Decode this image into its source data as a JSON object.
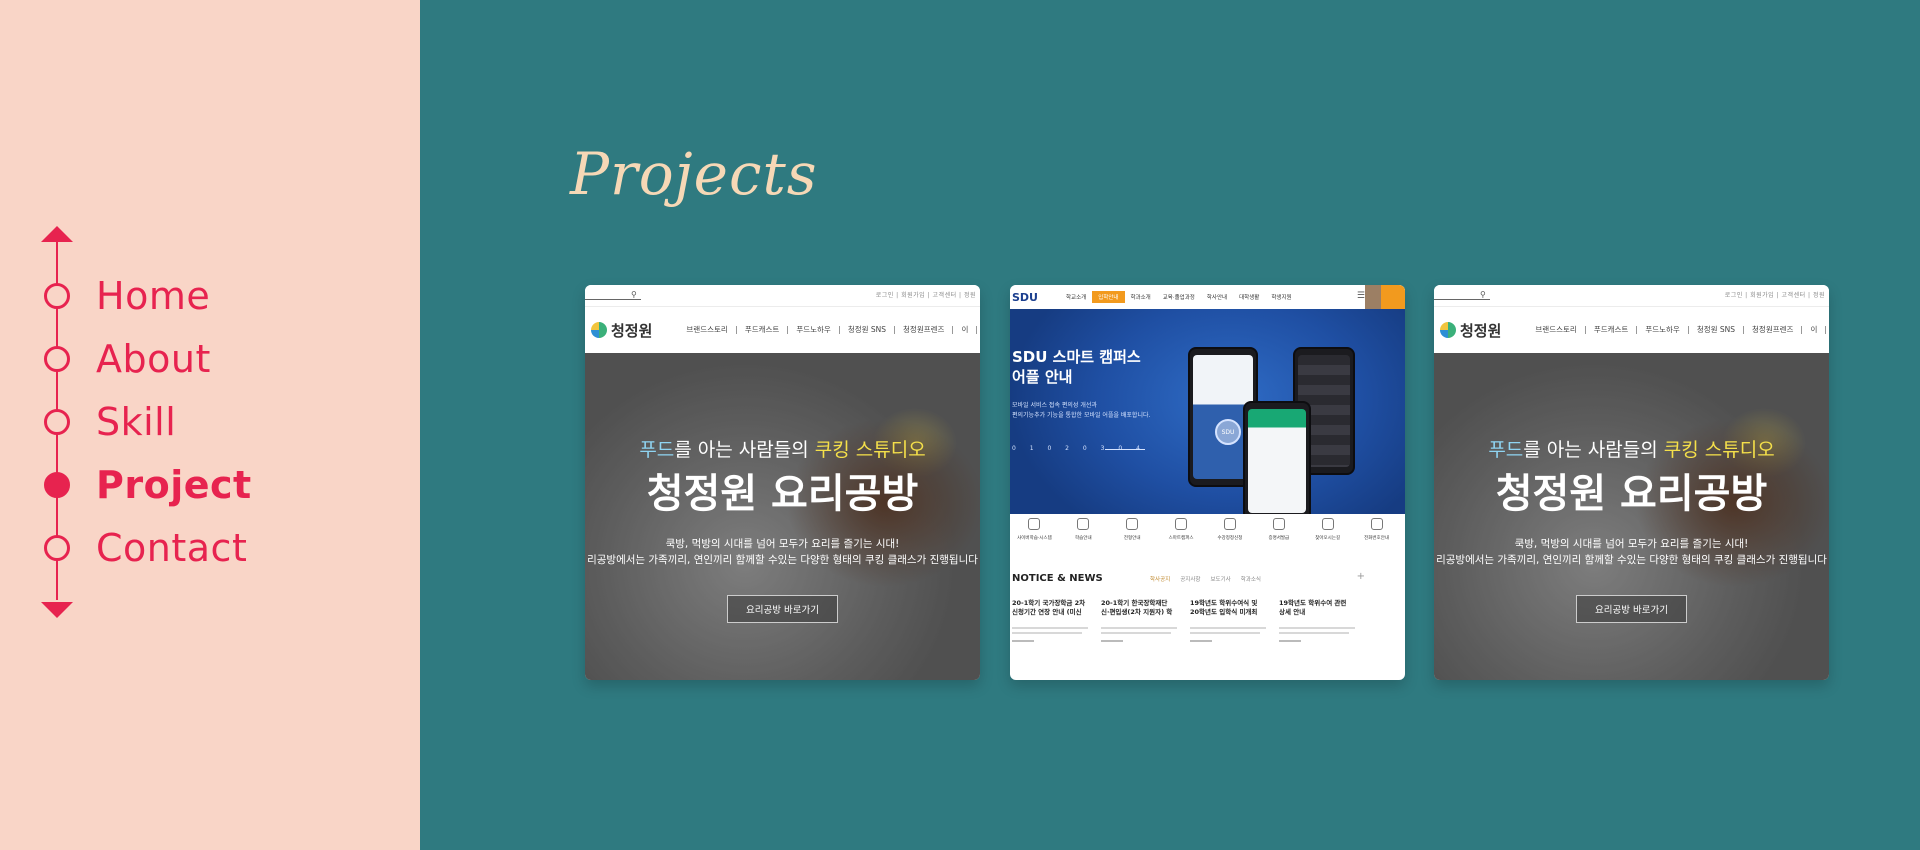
{
  "nav": {
    "items": [
      {
        "label": "Home",
        "active": false
      },
      {
        "label": "About",
        "active": false
      },
      {
        "label": "Skill",
        "active": false
      },
      {
        "label": "Project",
        "active": true
      },
      {
        "label": "Contact",
        "active": false
      }
    ]
  },
  "main": {
    "title": "Projects",
    "cards": [
      {
        "kind": "food-site",
        "logo": "청정원",
        "menu": [
          "브랜드스토리",
          "푸드캐스트",
          "푸드노하우",
          "청정원 SNS",
          "청정원프렌즈",
          "이"
        ],
        "util": "로그인 | 회원가입 | 고객센터 | 정원",
        "hero_sub_pre": "푸드",
        "hero_sub_mid": "를 아는 사람들의 ",
        "hero_sub_post": "쿠킹 스튜디오",
        "hero_title": "청정원 요리공방",
        "hero_desc1": "쿡방, 먹방의 시대를 넘어 모두가 요리를 즐기는 시대!",
        "hero_desc2": "리공방에서는 가족끼리, 연인끼리 함께할 수있는 다양한 형태의 쿠킹 클래스가 진행됩니다",
        "button": "요리공방 바로가기"
      },
      {
        "kind": "sdu-site",
        "logo": "SDU",
        "menu": [
          "학교소개",
          "입학안내",
          "학과소개",
          "교육·졸업과정",
          "학사안내",
          "대학생활",
          "학생지원"
        ],
        "hero_title": "SDU 스마트 캠퍼스\n어플 안내",
        "hero_desc": "모바일 서비스 접속 편의성 개선과\n편의기능추가 기능을 통합한 모바일 어플을 배포합니다.",
        "hero_dots": "0 1 0 2 0 3 0 4",
        "seal": "SDU",
        "quick_icons": [
          "사이버학습·시스템",
          "학습안내",
          "전형안내",
          "스마트캠퍼스",
          "수강정정신청",
          "증명서발급",
          "찾아오시는길",
          "전화번호안내"
        ],
        "news_title": "NOTICE & NEWS",
        "news_tabs": [
          "학사공지",
          "공지사항",
          "보도기사",
          "학과소식"
        ],
        "news_items": [
          "20-1학기 국가장학금 2차\n신청기간 연장 안내 (미신",
          "20-1학기 한국장학재단\n신·편입생(2차 지원자) 학",
          "19학년도 학위수여식 및\n20학년도 입학식 미개최",
          "19학년도 학위수여 관련\n상세 안내"
        ]
      },
      {
        "kind": "food-site",
        "logo": "청정원",
        "menu": [
          "브랜드스토리",
          "푸드캐스트",
          "푸드노하우",
          "청정원 SNS",
          "청정원프렌즈",
          "이"
        ],
        "util": "로그인 | 회원가입 | 고객센터 | 정원",
        "hero_sub_pre": "푸드",
        "hero_sub_mid": "를 아는 사람들의 ",
        "hero_sub_post": "쿠킹 스튜디오",
        "hero_title": "청정원 요리공방",
        "hero_desc1": "쿡방, 먹방의 시대를 넘어 모두가 요리를 즐기는 시대!",
        "hero_desc2": "리공방에서는 가족끼리, 연인끼리 함께할 수있는 다양한 형태의 쿠킹 클래스가 진행됩니다",
        "button": "요리공방 바로가기"
      }
    ]
  },
  "colors": {
    "sidebar_bg": "#f9d5c7",
    "accent": "#e7234f",
    "main_bg": "#2f7a80",
    "title": "#f6d8b6"
  },
  "icons": {
    "nav_top": "arrow-up-icon",
    "nav_bottom": "arrow-down-icon",
    "decoration": "telephone-icon"
  }
}
